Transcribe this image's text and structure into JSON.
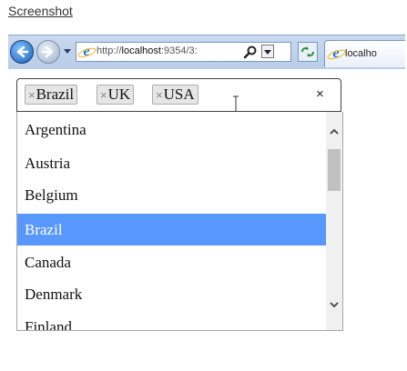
{
  "page": {
    "title_link": "Screenshot"
  },
  "browser": {
    "address_url_prefix": "http://",
    "address_url_host": "localhost",
    "address_url_rest": ":9354/3:",
    "tab_title": "localho"
  },
  "multiselect": {
    "tokens": [
      {
        "remove": "×",
        "label": "Brazil"
      },
      {
        "remove": "×",
        "label": "UK"
      },
      {
        "remove": "×",
        "label": "USA"
      }
    ],
    "clear_all": "×"
  },
  "dropdown": {
    "options": [
      "Argentina",
      "Austria",
      "Belgium",
      "Brazil",
      "Canada",
      "Denmark",
      "Finland"
    ],
    "highlighted": "Brazil"
  },
  "colors": {
    "highlight": "#5897fb",
    "token_bg": "#e6e6e6"
  }
}
